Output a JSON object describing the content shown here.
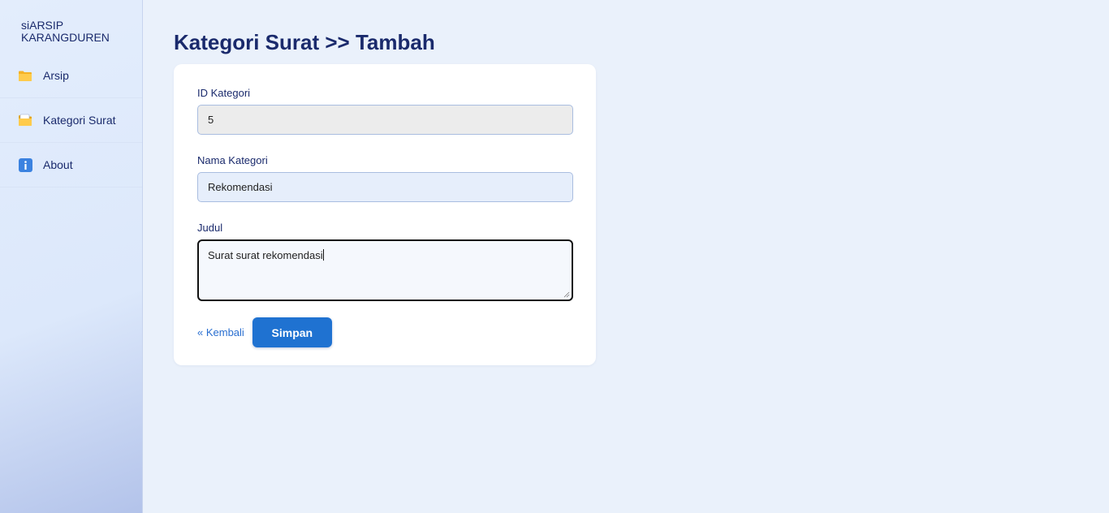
{
  "sidebar": {
    "brand_line1": "siARSIP",
    "brand_line2": "KARANGDUREN",
    "items": [
      {
        "label": "Arsip",
        "icon": "folder-icon"
      },
      {
        "label": "Kategori Surat",
        "icon": "folder-tab-icon"
      },
      {
        "label": "About",
        "icon": "info-icon"
      }
    ]
  },
  "page": {
    "title": "Kategori Surat >> Tambah"
  },
  "form": {
    "id_label": "ID Kategori",
    "id_value": "5",
    "name_label": "Nama Kategori",
    "name_value": "Rekomendasi",
    "title_label": "Judul",
    "title_value": "Surat surat rekomendasi",
    "back_label": "« Kembali",
    "save_label": "Simpan"
  },
  "colors": {
    "accent": "#1f72d1",
    "text_primary": "#1a2a6c",
    "link": "#2a6fd0",
    "background": "#eaf1fb"
  }
}
